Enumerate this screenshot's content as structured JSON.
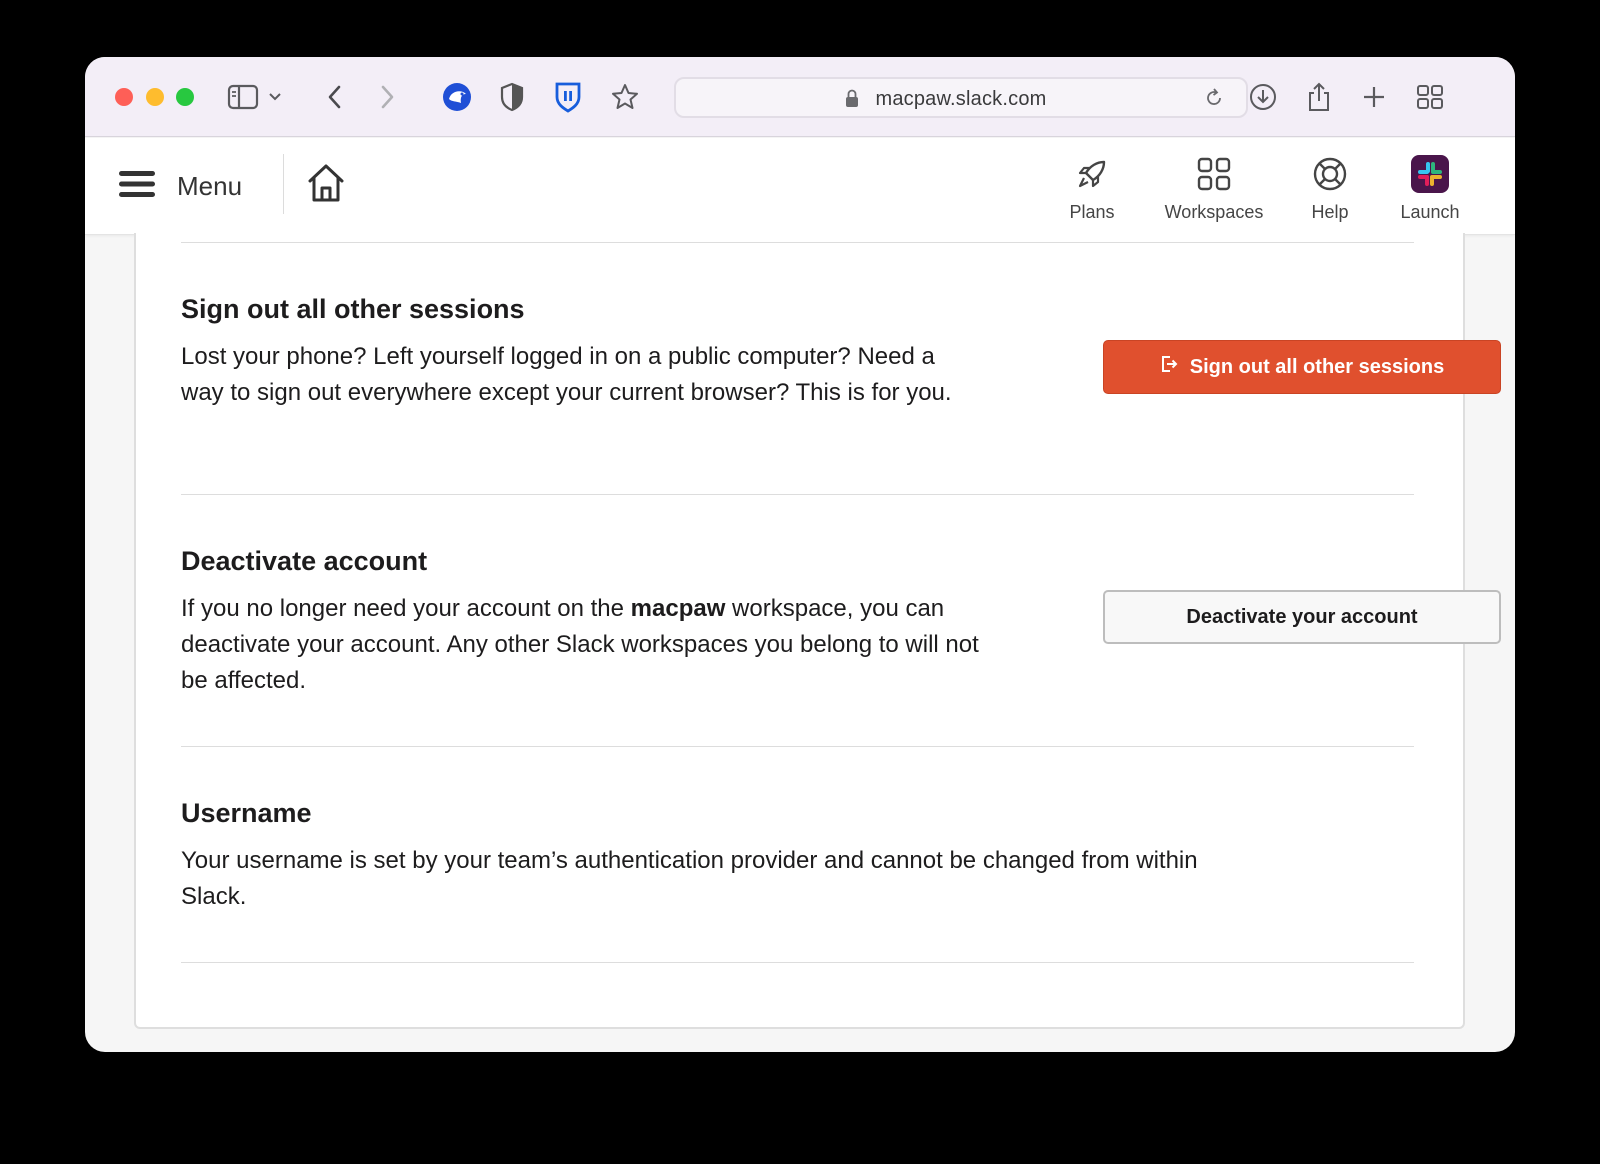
{
  "browser": {
    "url": "macpaw.slack.com",
    "icons": {
      "sidebar": "sidebar-icon",
      "sidebar_dropdown": "chevron-down-icon",
      "back": "chevron-left-icon",
      "forward": "chevron-right-icon",
      "ext1": "bird-extension-icon",
      "ext2": "half-shield-icon",
      "ext3": "bitwarden-shield-icon",
      "bookmark": "star-icon",
      "reload": "reload-icon",
      "download": "download-icon",
      "share": "share-icon",
      "new_tab": "plus-icon",
      "tab_overview": "grid-icon"
    }
  },
  "header": {
    "menu_label": "Menu",
    "nav": [
      {
        "label": "Plans",
        "icon": "rocket-icon"
      },
      {
        "label": "Workspaces",
        "icon": "workspaces-grid-icon"
      },
      {
        "label": "Help",
        "icon": "lifebuoy-icon"
      },
      {
        "label": "Launch",
        "icon": "slack-logo-icon"
      }
    ]
  },
  "sections": {
    "sign_out": {
      "title": "Sign out all other sessions",
      "description": "Lost your phone? Left yourself logged in on a public computer? Need a way to sign out everywhere except your current browser? This is for you.",
      "button_label": "Sign out all other sessions"
    },
    "deactivate": {
      "title": "Deactivate account",
      "desc_before": "If you no longer need your account on the ",
      "desc_workspace": "macpaw",
      "desc_after": " workspace, you can deactivate your account. Any other Slack workspaces you belong to will not be affected.",
      "button_label": "Deactivate your account"
    },
    "username": {
      "title": "Username",
      "description": "Your username is set by your team’s authentication provider and cannot be changed from within Slack."
    }
  },
  "colors": {
    "danger_button": "#e0502e",
    "toolbar_bg": "#f3eef7",
    "text_primary": "#1d1c1d"
  }
}
